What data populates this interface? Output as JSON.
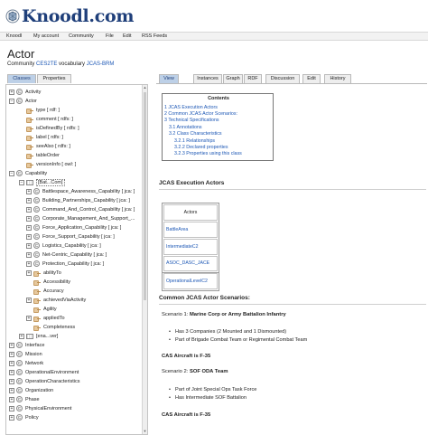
{
  "brand": {
    "name": "Knoodl.com"
  },
  "menu": [
    "Knoodl",
    "My account",
    "Community",
    "File",
    "Edit",
    "RSS Feeds"
  ],
  "page": {
    "title": "Actor"
  },
  "subtitle": {
    "community_label": "Community",
    "community": "CES2TE",
    "vocab_label": "vocabulary",
    "vocab": "JCAS-BRM"
  },
  "left_tabs": [
    "Classes",
    "Properties"
  ],
  "right_tabs": [
    "View",
    "Instances",
    "Graph",
    "RDF",
    "Discussion",
    "Edit",
    "History"
  ],
  "tree": [
    {
      "label": "Activity",
      "type": "class",
      "level": 0,
      "exp": "+"
    },
    {
      "label": "Actor",
      "type": "class",
      "level": 0,
      "exp": "-"
    },
    {
      "label": "type [ rdf: ]",
      "type": "prop",
      "level": 1
    },
    {
      "label": "comment [ rdfs: ]",
      "type": "prop",
      "level": 1
    },
    {
      "label": "isDefinedBy [ rdfs: ]",
      "type": "prop",
      "level": 1
    },
    {
      "label": "label [ rdfs: ]",
      "type": "prop",
      "level": 1
    },
    {
      "label": "seeAlso [ rdfs: ]",
      "type": "prop",
      "level": 1
    },
    {
      "label": "tableOrder",
      "type": "prop",
      "level": 1
    },
    {
      "label": "versionInfo [ owl: ]",
      "type": "prop",
      "level": 1
    },
    {
      "label": "Capability",
      "type": "class",
      "level": 0,
      "exp": "-"
    },
    {
      "label": "[Bat...Com]",
      "type": "group",
      "level": 1,
      "exp": "-",
      "selected": true
    },
    {
      "label": "Battlespace_Awareness_Capability [ jca: ]",
      "type": "class",
      "level": 2,
      "exp": "+"
    },
    {
      "label": "Building_Partnerships_Capability [ jca: ]",
      "type": "class",
      "level": 2,
      "exp": "+"
    },
    {
      "label": "Command_And_Control_Capability [ jca: ]",
      "type": "class",
      "level": 2,
      "exp": "+"
    },
    {
      "label": "Corporate_Management_And_Support_...",
      "type": "class",
      "level": 2,
      "exp": "+"
    },
    {
      "label": "Force_Application_Capability [ jca: ]",
      "type": "class",
      "level": 2,
      "exp": "+"
    },
    {
      "label": "Force_Support_Capability [ jca: ]",
      "type": "class",
      "level": 2,
      "exp": "+"
    },
    {
      "label": "Logistics_Capability [ jca: ]",
      "type": "class",
      "level": 2,
      "exp": "+"
    },
    {
      "label": "Net-Centric_Capability [ jca: ]",
      "type": "class",
      "level": 2,
      "exp": "+"
    },
    {
      "label": "Protection_Capability [ jca: ]",
      "type": "class",
      "level": 2,
      "exp": "+"
    },
    {
      "label": "abilityTo",
      "type": "prop",
      "level": 2,
      "exp": "+"
    },
    {
      "label": "Accessibility",
      "type": "prop",
      "level": 2
    },
    {
      "label": "Accuracy",
      "type": "prop",
      "level": 2
    },
    {
      "label": "achievedViaActivity",
      "type": "prop",
      "level": 2,
      "exp": "+"
    },
    {
      "label": "Agility",
      "type": "prop",
      "level": 2
    },
    {
      "label": "appliedTo",
      "type": "prop",
      "level": 2,
      "exp": "+"
    },
    {
      "label": "Completeness",
      "type": "prop",
      "level": 2
    },
    {
      "label": "[ena...ver]",
      "type": "group",
      "level": 1,
      "exp": "+"
    },
    {
      "label": "Interface",
      "type": "class",
      "level": 0,
      "exp": "+"
    },
    {
      "label": "Mission",
      "type": "class",
      "level": 0,
      "exp": "+"
    },
    {
      "label": "Network",
      "type": "class",
      "level": 0,
      "exp": "+"
    },
    {
      "label": "OperationalEnvironment",
      "type": "class",
      "level": 0,
      "exp": "+"
    },
    {
      "label": "OperationCharacteristics",
      "type": "class",
      "level": 0,
      "exp": "+"
    },
    {
      "label": "Organization",
      "type": "class",
      "level": 0,
      "exp": "+"
    },
    {
      "label": "Phase",
      "type": "class",
      "level": 0,
      "exp": "+"
    },
    {
      "label": "PhysicalEnvironment",
      "type": "class",
      "level": 0,
      "exp": "+"
    },
    {
      "label": "Policy",
      "type": "class",
      "level": 0,
      "exp": "+"
    }
  ],
  "toc": {
    "title": "Contents",
    "items": [
      "1 JCAS Execution Actors",
      "2 Common JCAS Actor Scenarios:",
      "3 Technical Specifications",
      "3.1 Annotations",
      "3.2 Class Characteristics",
      "3.2.1 Relationships",
      "3.2.2 Declared properties",
      "3.2.3 Properties using this class"
    ]
  },
  "content": {
    "section1": "JCAS Execution Actors",
    "table_header": "Actors",
    "actors": [
      "BattleArea",
      "IntermediateC2",
      "ASOC_DASC_JACE",
      "OperationalLevelC2"
    ],
    "section2": "Common JCAS Actor Scenarios:",
    "scenario1_label": "Scenario 1:",
    "scenario1_title": "Marine Corp or Army Battalion Infantry",
    "scenario1_bullets": [
      "Has 3 Companies (2 Mounted and 1 Dismounted)",
      "Part of Brigade Combat Team or Regimental Combat Team"
    ],
    "cas1": "CAS Aircraft is F-35",
    "scenario2_label": "Scenario 2:",
    "scenario2_title": "SOF ODA Team",
    "scenario2_bullets": [
      "Part of Joint Special Ops Task Force",
      "Has Intermediate SOF Battalion"
    ],
    "cas2": "CAS Aircraft is F-35"
  }
}
